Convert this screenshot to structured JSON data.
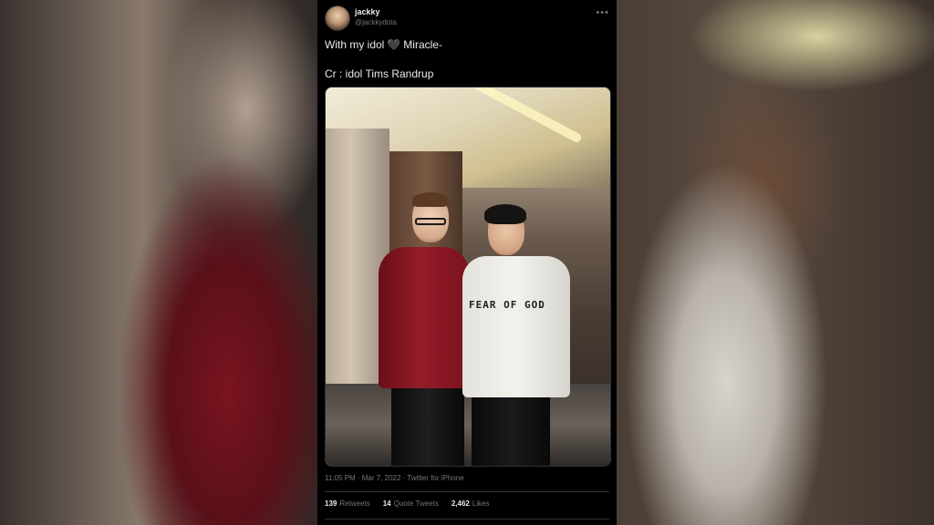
{
  "tweet": {
    "user_name": "jackky",
    "user_handle": "@jackkydota",
    "text_line1_before": "With my idol",
    "text_heart": "🖤",
    "text_line1_after": "Miracle-",
    "text_line2": "Cr : idol Tims Randrup",
    "timestamp": "11:05 PM · Mar 7, 2022 · Twitter for iPhone",
    "retweets_count": "139",
    "retweets_label": "Retweets",
    "quote_tweets_count": "14",
    "quote_tweets_label": "Quote Tweets",
    "likes_count": "2,462",
    "likes_label": "Likes",
    "photo": {
      "shirt_text": "FEAR OF GOD"
    }
  },
  "colors": {
    "background": "#000000",
    "text_primary": "#e7e9ea",
    "text_secondary": "#71767b",
    "divider": "#2f3336"
  },
  "icons": {
    "more": "more-options-icon"
  }
}
